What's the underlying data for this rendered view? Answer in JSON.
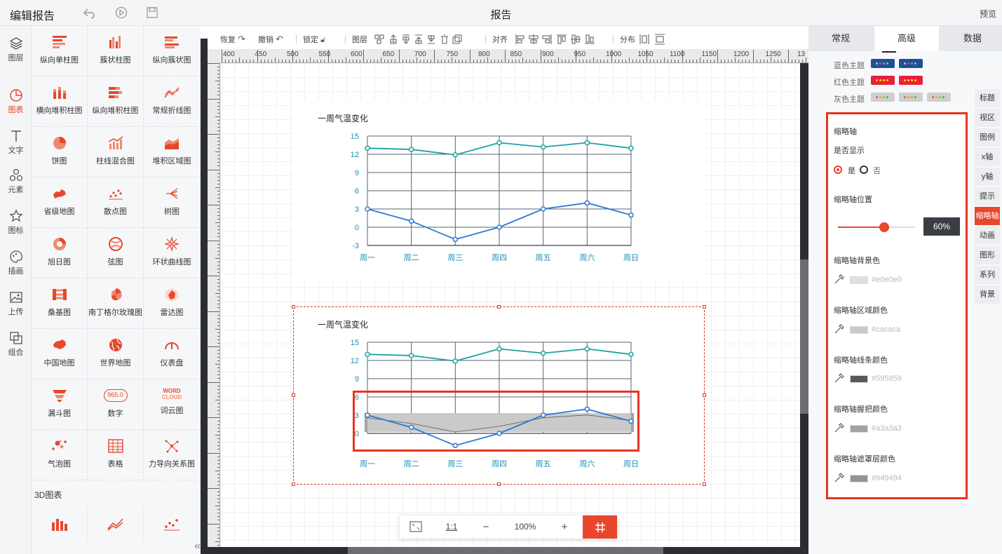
{
  "app": {
    "title": "编辑报告",
    "page_title": "报告",
    "preview_label": "预览"
  },
  "leftnav": {
    "items": [
      {
        "label": "图层",
        "icon": "layers-icon"
      },
      {
        "label": "图表",
        "icon": "chart-pie-icon",
        "active": true
      },
      {
        "label": "文字",
        "icon": "text-icon"
      },
      {
        "label": "元素",
        "icon": "elements-icon"
      },
      {
        "label": "图标",
        "icon": "star-icon"
      },
      {
        "label": "插画",
        "icon": "palette-icon"
      },
      {
        "label": "上传",
        "icon": "image-upload-icon"
      },
      {
        "label": "组合",
        "icon": "group-icon"
      }
    ]
  },
  "catalog": {
    "items": [
      "纵向单柱图",
      "簇状柱图",
      "纵向簇状图",
      "横向堆积柱图",
      "纵向堆积柱图",
      "常规折线图",
      "饼图",
      "柱线混合图",
      "堆积区域图",
      "省级地图",
      "散点图",
      "树图",
      "旭日图",
      "弦图",
      "环状曲线图",
      "桑基图",
      "南丁格尔玫瑰图",
      "雷达图",
      "中国地图",
      "世界地图",
      "仪表盘",
      "漏斗图",
      "数字",
      "词云图",
      "气泡图",
      "表格",
      "力导向关系图"
    ],
    "section_3d": "3D图表",
    "number_icon_text": "965.0",
    "wordcloud_icon_text_1": "WORD",
    "wordcloud_icon_text_2": "CLOUD"
  },
  "toolbar": {
    "redo": "恢复",
    "undo": "撤销",
    "lock": "锁定",
    "layer": "图层",
    "align": "对齐",
    "distribute": "分布"
  },
  "ruler": {
    "top": [
      "400",
      "450",
      "500",
      "550",
      "600",
      "650",
      "700",
      "750",
      "800",
      "850",
      "900",
      "950",
      "1000",
      "1050",
      "1100",
      "1150",
      "1200",
      "1250",
      "13"
    ]
  },
  "charts": [
    {
      "title": "一周气温变化"
    },
    {
      "title": "一周气温变化"
    }
  ],
  "chart_data": [
    {
      "type": "line",
      "title": "一周气温变化",
      "categories": [
        "周一",
        "周二",
        "周三",
        "周四",
        "周五",
        "周六",
        "周日"
      ],
      "y_ticks": [
        "15",
        "12",
        "9",
        "6",
        "3",
        "0",
        "-3"
      ],
      "ylim": [
        -3,
        15
      ],
      "series": [
        {
          "values": [
            13,
            12.8,
            11.9,
            13.9,
            13.2,
            13.9,
            13
          ],
          "color": "#1aa3a3"
        },
        {
          "values": [
            3,
            1,
            -2,
            0,
            3,
            4,
            2
          ],
          "color": "#2a7bd6"
        }
      ],
      "grid": true
    },
    {
      "type": "line",
      "title": "一周气温变化",
      "categories": [
        "周一",
        "周二",
        "周三",
        "周四",
        "周五",
        "周六",
        "周日"
      ],
      "y_ticks": [
        "15",
        "12",
        "9",
        "6",
        "3",
        "0"
      ],
      "ylim": [
        -3,
        15
      ],
      "series": [
        {
          "values": [
            13,
            12.8,
            11.9,
            13.9,
            13.2,
            13.9,
            13
          ],
          "color": "#1aa3a3"
        },
        {
          "values": [
            3,
            1,
            -2,
            0,
            3,
            4,
            2
          ],
          "color": "#2a7bd6"
        }
      ],
      "grid": true,
      "data_zoom": {
        "visible": true
      }
    }
  ],
  "zoombar": {
    "ratio": "1:1",
    "minus": "−",
    "zoom": "100%",
    "plus": "+"
  },
  "rightpanel": {
    "tabs": [
      "常规",
      "高级",
      "数据"
    ],
    "active_tab": "高级",
    "themes": [
      {
        "label": "蓝色主题",
        "colors": [
          "#1d4f9a",
          "#1d4f9a"
        ],
        "dots": [
          "#f5c242",
          "#e8472c",
          "#3fa7f2",
          "#8bd14b"
        ]
      },
      {
        "label": "红色主题",
        "colors": [
          "#e8203c",
          "#e8203c"
        ],
        "dots": [
          "#ffd800",
          "#ffd800",
          "#ffd800",
          "#ffd800"
        ]
      },
      {
        "label": "灰色主题",
        "colors": [
          "#cfcfcf",
          "#cfcfcf",
          "#cfcfcf"
        ],
        "dots": [
          "#e85a4f",
          "#f5a623",
          "#8bc34a",
          "#4caf50"
        ]
      }
    ],
    "side_tabs": [
      "标题",
      "视区",
      "图例",
      "x轴",
      "y轴",
      "提示",
      "缩略轴",
      "动画",
      "图形",
      "系列",
      "背景"
    ],
    "active_side_tab": "缩略轴",
    "section_title": "缩略轴",
    "show_label": "是否显示",
    "yes": "是",
    "no": "否",
    "position_label": "缩略轴位置",
    "position_value": "60%",
    "position_fraction": 0.6,
    "bg_label": "缩略轴背景色",
    "bg_color": "#e0e0e0",
    "area_label": "缩略轴区域颜色",
    "area_color": "#cacaca",
    "line_label": "缩略轴线条颜色",
    "line_color": "#595959",
    "handle_label": "缩略轴握把颜色",
    "handle_color": "#a3a3a3",
    "mask_label": "缩略轴遮罩层颜色",
    "mask_color": "#949494"
  },
  "colors": {
    "accent": "#e8472c",
    "highlight": "#e8341f"
  }
}
